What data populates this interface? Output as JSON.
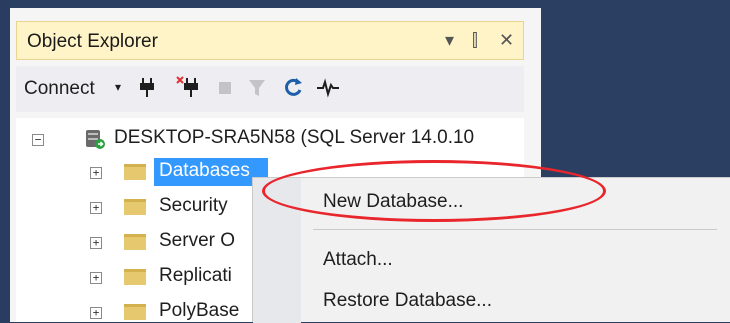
{
  "panel": {
    "title": "Object Explorer",
    "controls": {
      "dropdown": "▾",
      "pin": "⫿",
      "close": "✕"
    }
  },
  "toolbar": {
    "connect_label": "Connect",
    "connect_caret": "▾",
    "icons": [
      "connect-plug-icon",
      "disconnect-plug-icon",
      "stop-icon",
      "filter-icon",
      "refresh-icon",
      "activity-monitor-icon"
    ]
  },
  "tree": {
    "server": {
      "label": "DESKTOP-SRA5N58 (SQL Server 14.0.10",
      "expander": "−"
    },
    "nodes": [
      {
        "label": "Databases",
        "expander": "+",
        "selected": true
      },
      {
        "label": "Security",
        "expander": "+"
      },
      {
        "label": "Server O",
        "expander": "+"
      },
      {
        "label": "Replicati",
        "expander": "+"
      },
      {
        "label": "PolyBase",
        "expander": "+"
      }
    ]
  },
  "context_menu": {
    "items": [
      {
        "label": "New Database..."
      },
      {
        "label": "Attach..."
      },
      {
        "label": "Restore Database..."
      }
    ]
  },
  "colors": {
    "background": "#2b3f63",
    "titlebar": "#fff4c7",
    "selection": "#3399ff",
    "highlight_circle": "#e8262b"
  }
}
